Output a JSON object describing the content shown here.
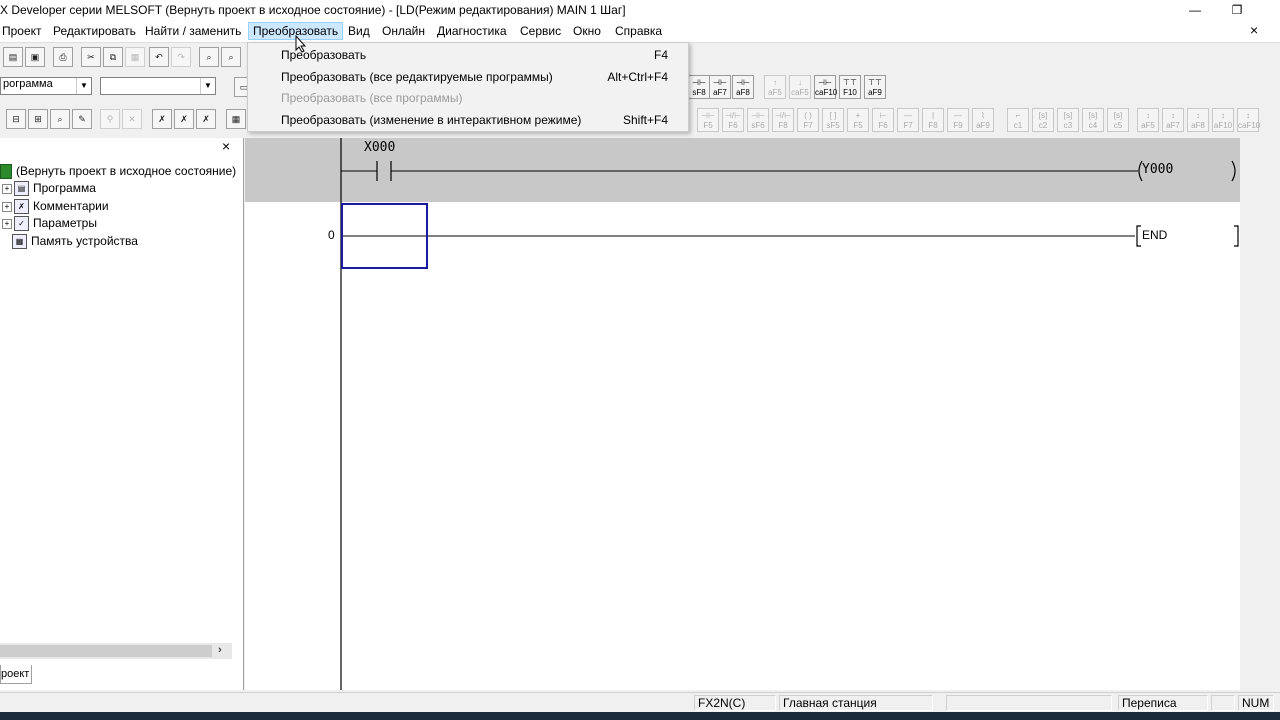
{
  "window": {
    "title": "X Developer серии MELSOFT (Вернуть проект в исходное состояние) - [LD(Режим редактирования)    MAIN    1 Шаг]",
    "minimize_glyph": "—",
    "restore_glyph": "❐"
  },
  "menubar": {
    "items": [
      "Проект",
      "Редактировать",
      "Найти / заменить",
      "Преобразовать",
      "Вид",
      "Онлайн",
      "Диагностика",
      "Сервис",
      "Окно",
      "Справка"
    ],
    "close_glyph": "×"
  },
  "dropdown": {
    "items": [
      {
        "label": "Преобразовать",
        "shortcut": "F4"
      },
      {
        "label": "Преобразовать (все редактируемые программы)",
        "shortcut": "Alt+Ctrl+F4"
      },
      {
        "label": "Преобразовать (все программы)",
        "shortcut": ""
      },
      {
        "label": "Преобразовать (изменение в интерактивном режиме)",
        "shortcut": "Shift+F4"
      }
    ]
  },
  "toolbar": {
    "program_combo_value": "рограмма",
    "second_combo_value": "",
    "fkeys_row1": [
      "sF8",
      "aF7",
      "aF8",
      "aF5",
      "caF5",
      "caF10",
      "F10",
      "aF9"
    ],
    "fkeys_row2": [
      "F5",
      "F6",
      "sF6",
      "F8",
      "F7",
      "sF5",
      "F5",
      "F6",
      "F7",
      "F8",
      "F9",
      "aF9",
      "c1",
      "c2",
      "c3",
      "c4",
      "c5",
      "aF5",
      "aF7",
      "aF8",
      "aF10",
      "caF10"
    ]
  },
  "tree": {
    "root": "(Вернуть проект в исходное состояние)",
    "items": [
      "Программа",
      "Комментарии",
      "Параметры",
      "Память устройства"
    ],
    "tab_label": "роект",
    "close_glyph": "×"
  },
  "ladder": {
    "contact_label": "X000",
    "coil_label": "Y000",
    "step_number": "0",
    "end_label": "END"
  },
  "statusbar": {
    "cpu": "FX2N(C)",
    "station": "Главная станция",
    "mode": "Переписа",
    "num": "NUM"
  }
}
